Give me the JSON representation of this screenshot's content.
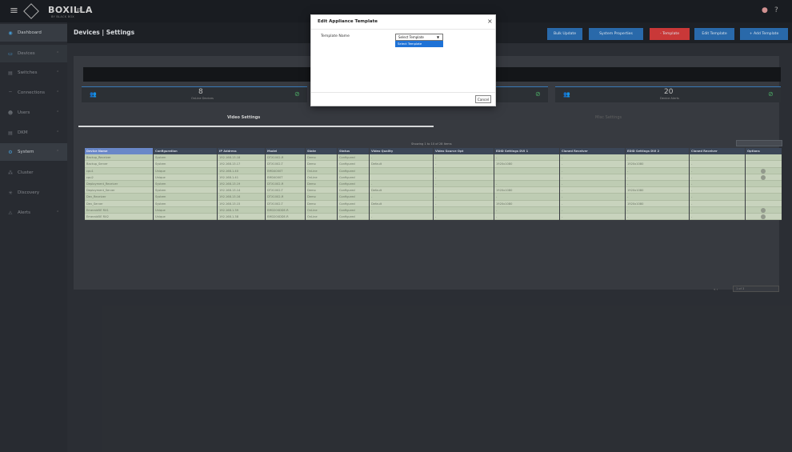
{
  "app": {
    "logo": "BOXILLA",
    "logo_sub": "BY BLACK BOX"
  },
  "sidebar": {
    "items": [
      {
        "label": "Dashboard",
        "icon": "dashboard-icon"
      },
      {
        "label": "Devices",
        "icon": "devices-icon"
      },
      {
        "label": "Switches",
        "icon": "switches-icon"
      },
      {
        "label": "Connections",
        "icon": "connections-icon"
      },
      {
        "label": "Users",
        "icon": "users-icon"
      },
      {
        "label": "DKM",
        "icon": "dkm-icon"
      },
      {
        "label": "System",
        "icon": "gear-icon"
      },
      {
        "label": "Cluster",
        "icon": "cluster-icon"
      },
      {
        "label": "Discovery",
        "icon": "discovery-icon"
      },
      {
        "label": "Alerts",
        "icon": "alert-icon"
      }
    ]
  },
  "header": {
    "title": "Devices | Settings",
    "buttons": {
      "bulk_update": "Bulk Update",
      "system_properties": "System Properties",
      "template": "- Template",
      "edit_template": "Edit Template",
      "add_template": "+ Add Template"
    }
  },
  "stats": {
    "online": {
      "value": "8",
      "label": "OnLine Devices"
    },
    "alerts": {
      "value": "20",
      "label": "Device Alerts"
    }
  },
  "tabs": {
    "video": "Video Settings",
    "misc": "Misc Settings"
  },
  "grid": {
    "showing": "Showing 1 to 10 of 28 Items",
    "headers": [
      "Device Name",
      "Configuration",
      "IP Address",
      "Model",
      "State",
      "Status",
      "Video Quality",
      "Video Source Opt",
      "EDID Settings DVI 1",
      "Cloned Receiver",
      "EDID Settings DVI 2",
      "Cloned Receiver",
      "Options"
    ],
    "rows": [
      [
        "Backup_Receiver",
        "System",
        "192.168.13.18",
        "DTX1002-R",
        "Demo",
        "Configured",
        "-",
        "-",
        "-",
        "-",
        "-",
        "-",
        ""
      ],
      [
        "Backup_Server",
        "System",
        "192.168.13.17",
        "DTX1002-T",
        "Demo",
        "Configured",
        "Default",
        "-",
        "1920x1080",
        "-",
        "1920x1080",
        "-",
        ""
      ],
      [
        "cpu1",
        "Unique",
        "192.168.1.40",
        "EMD4000T",
        "OnLine",
        "Configured",
        "",
        "-",
        "",
        "-",
        "-",
        "-",
        "o"
      ],
      [
        "cpu2",
        "Unique",
        "192.168.1.41",
        "EMD4000T",
        "OnLine",
        "Configured",
        "",
        "-",
        "",
        "-",
        "-",
        "-",
        "o"
      ],
      [
        "Deployment_Receiver",
        "System",
        "192.168.13.19",
        "DTX1002-R",
        "Demo",
        "Configured",
        "-",
        "-",
        "-",
        "-",
        "-",
        "-",
        ""
      ],
      [
        "Deployment_Server",
        "System",
        "192.168.13.14",
        "DTX1002-T",
        "Demo",
        "Configured",
        "Default",
        "-",
        "1920x1080",
        "-",
        "1920x1080",
        "-",
        ""
      ],
      [
        "Dev_Receiver",
        "System",
        "192.168.13.16",
        "DTX1002-R",
        "Demo",
        "Configured",
        "-",
        "-",
        "-",
        "-",
        "-",
        "-",
        ""
      ],
      [
        "Dev_Server",
        "System",
        "192.168.13.15",
        "DTX1002-T",
        "Demo",
        "Configured",
        "Default",
        "-",
        "1920x1080",
        "-",
        "1920x1080",
        "-",
        ""
      ],
      [
        "Emerald5E RX1",
        "Unique",
        "192.168.1.39",
        "EMD200DDE-R",
        "OnLine",
        "Configured",
        "-",
        "-",
        "-",
        "-",
        "-",
        "-",
        "o"
      ],
      [
        "Emerald5E RX2",
        "Unique",
        "192.168.1.38",
        "EMD200DDE-R",
        "OnLine",
        "Configured",
        "-",
        "-",
        "-",
        "-",
        "-",
        "-",
        "o"
      ]
    ],
    "pager": "1 of 3"
  },
  "modal": {
    "title": "Edit Appliance Template",
    "close": "×",
    "field_label": "Template Name",
    "select_value": "Select Template",
    "dropdown_option": "Select Template",
    "cancel": "Cancel"
  }
}
